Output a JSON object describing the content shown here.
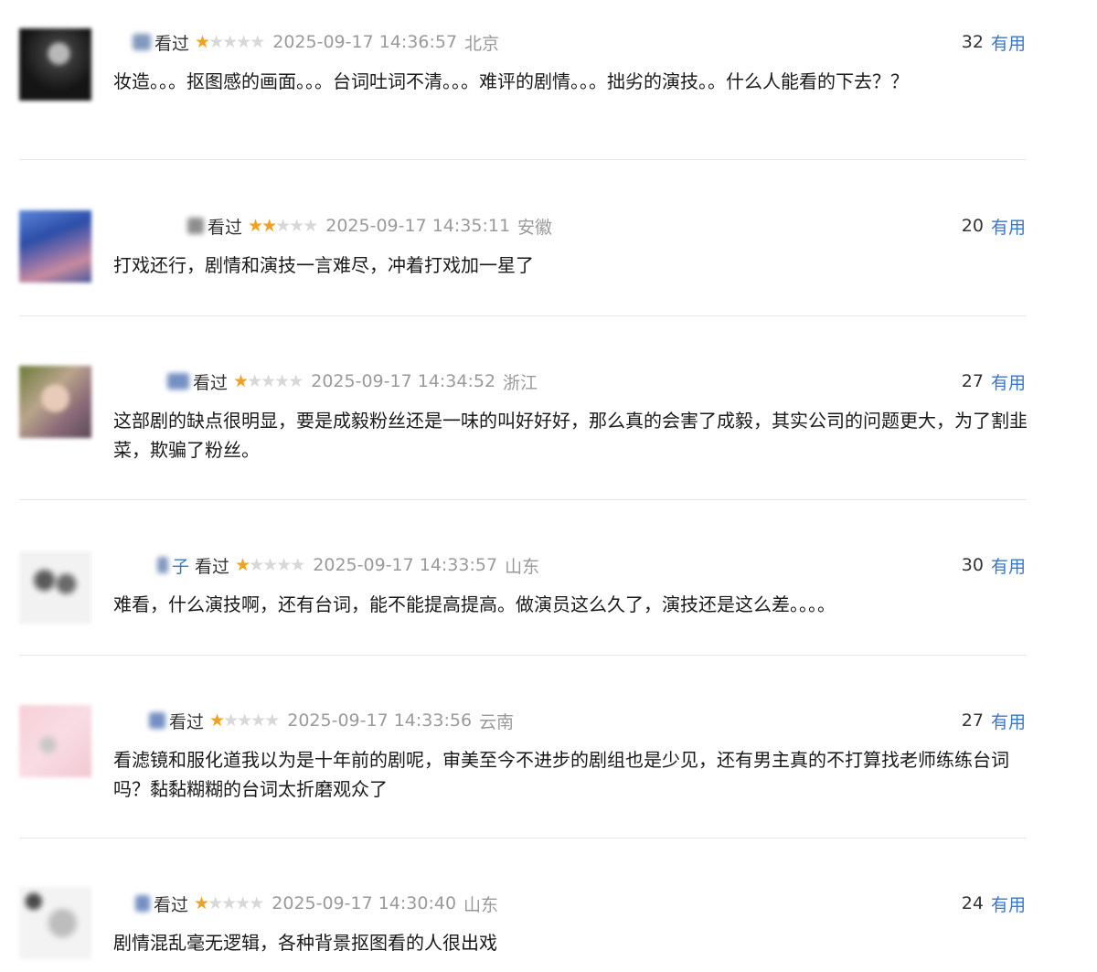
{
  "reviews": [
    {
      "status": "看过",
      "rating": 1,
      "time": "2025-09-17 14:36:57",
      "location": "北京",
      "votes": "32",
      "useful_label": "有用",
      "text": "妆造。。。抠图感的画面。。。台词吐词不清。。。难评的剧情。。。拙劣的演技。。什么人能看的下去？？",
      "visible_name": ""
    },
    {
      "status": "看过",
      "rating": 2,
      "time": "2025-09-17 14:35:11",
      "location": "安徽",
      "votes": "20",
      "useful_label": "有用",
      "text": "打戏还行，剧情和演技一言难尽，冲着打戏加一星了",
      "visible_name": ""
    },
    {
      "status": "看过",
      "rating": 1,
      "time": "2025-09-17 14:34:52",
      "location": "浙江",
      "votes": "27",
      "useful_label": "有用",
      "text": "这部剧的缺点很明显，要是成毅粉丝还是一味的叫好好好，那么真的会害了成毅，其实公司的问题更大，为了割韭菜，欺骗了粉丝。",
      "visible_name": ""
    },
    {
      "status": "看过",
      "rating": 1,
      "time": "2025-09-17 14:33:57",
      "location": "山东",
      "votes": "30",
      "useful_label": "有用",
      "text": "难看，什么演技啊，还有台词，能不能提高提高。做演员这么久了，演技还是这么差。。。。",
      "visible_name": "子"
    },
    {
      "status": "看过",
      "rating": 1,
      "time": "2025-09-17 14:33:56",
      "location": "云南",
      "votes": "27",
      "useful_label": "有用",
      "text": "看滤镜和服化道我以为是十年前的剧呢，审美至今不进步的剧组也是少见，还有男主真的不打算找老师练练台词吗？黏黏糊糊的台词太折磨观众了",
      "visible_name": ""
    },
    {
      "status": "看过",
      "rating": 1,
      "time": "2025-09-17 14:30:40",
      "location": "山东",
      "votes": "24",
      "useful_label": "有用",
      "text": "剧情混乱毫无逻辑，各种背景抠图看的人很出戏",
      "visible_name": ""
    }
  ],
  "colors": {
    "star_on": "#f0a022",
    "star_off": "#d8d8d8",
    "link": "#3a77c8",
    "meta_gray": "#9a9a9a",
    "divider": "#e6e6e6"
  }
}
